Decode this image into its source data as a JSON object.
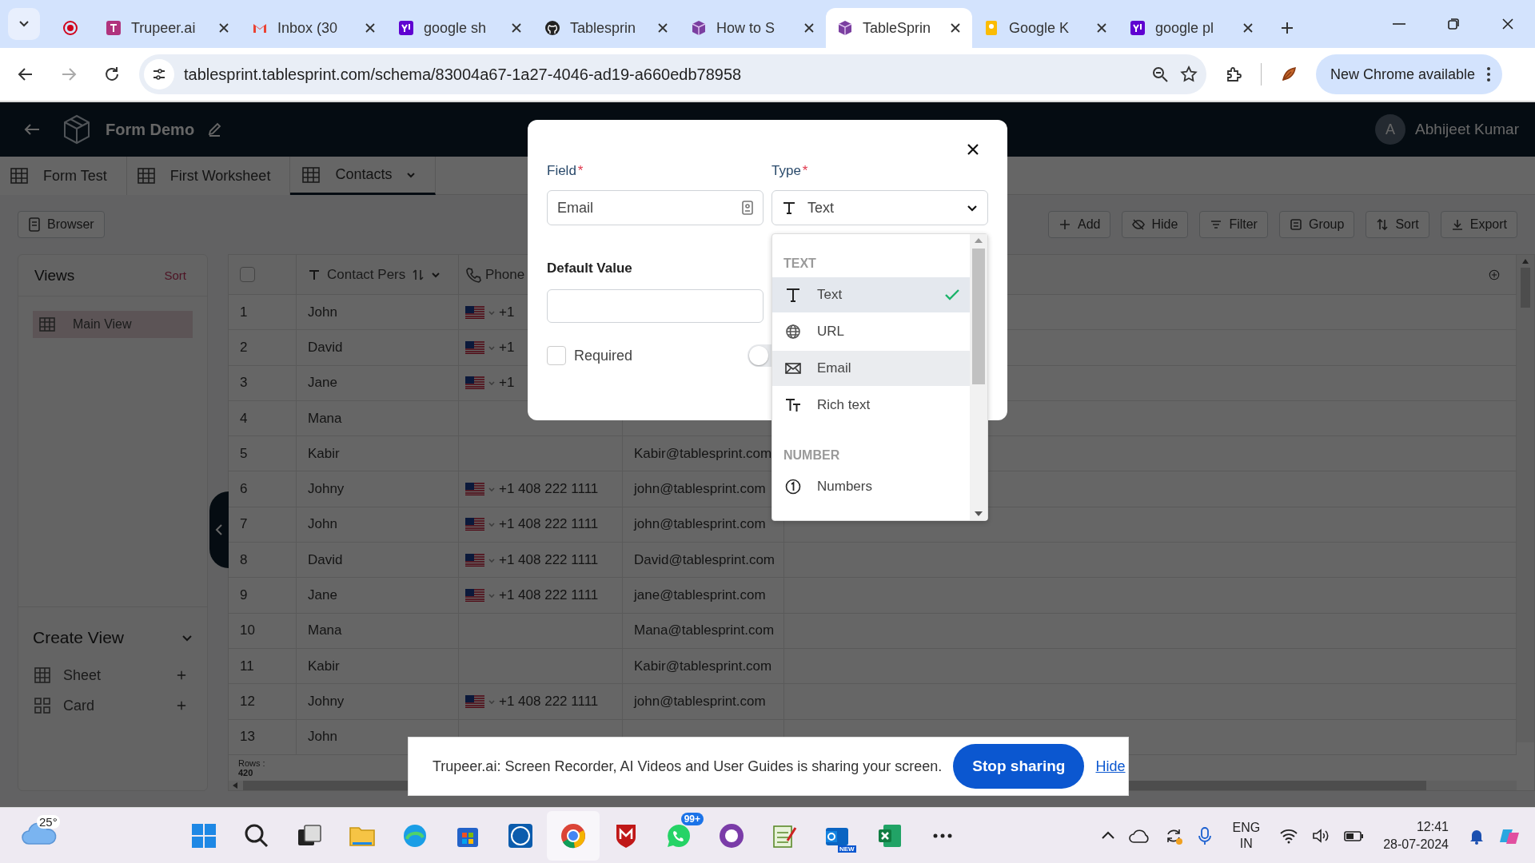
{
  "browser": {
    "tabs": [
      {
        "pinned": true,
        "selected": false
      },
      {
        "title": "Trupeer.ai",
        "selected": false
      },
      {
        "title": "Inbox (30",
        "selected": false
      },
      {
        "title": "google sh",
        "selected": false
      },
      {
        "title": "Tablesprin",
        "selected": false
      },
      {
        "title": "How to S",
        "selected": false
      },
      {
        "title": "TableSprin",
        "selected": true
      },
      {
        "title": "Google K",
        "selected": false
      },
      {
        "title": "google pl",
        "selected": false
      }
    ],
    "url": "tablesprint.tablesprint.com/schema/83004a67-1a27-4046-ad19-a660edb78958",
    "update_button": "New Chrome available"
  },
  "app": {
    "title": "Form Demo",
    "user": {
      "initial": "A",
      "name": "Abhijeet Kumar"
    },
    "sheet_tabs": [
      {
        "label": "Form Test",
        "selected": false
      },
      {
        "label": "First Worksheet",
        "selected": false
      },
      {
        "label": "Contacts",
        "selected": true
      }
    ],
    "toolbar": {
      "left": "Browser",
      "right": [
        "Add",
        "Hide",
        "Filter",
        "Group",
        "Sort",
        "Export"
      ]
    },
    "sidebar": {
      "views_title": "Views",
      "sort_label": "Sort",
      "views": [
        {
          "label": "Main View",
          "selected": true
        }
      ],
      "create_title": "Create View",
      "create_items": [
        "Sheet",
        "Card"
      ]
    },
    "table": {
      "select_all": {
        "checked": false
      },
      "columns": [
        {
          "label": "Contact Pers"
        },
        {
          "label": "Phone"
        }
      ],
      "rows": [
        {
          "num": "1",
          "name": "John",
          "phone": "+1"
        },
        {
          "num": "2",
          "name": "David",
          "phone": "+1"
        },
        {
          "num": "3",
          "name": "Jane",
          "phone": "+1"
        },
        {
          "num": "4",
          "name": "Mana"
        },
        {
          "num": "5",
          "name": "Kabir",
          "email": "Kabir@tablesprint.com"
        },
        {
          "num": "6",
          "name": "Johny",
          "phone": "+1 408 222 1111",
          "email": "john@tablesprint.com"
        },
        {
          "num": "7",
          "name": "John",
          "phone": "+1 408 222 1111",
          "email": "john@tablesprint.com"
        },
        {
          "num": "8",
          "name": "David",
          "phone": "+1 408 222 1111",
          "email": "David@tablesprint.com"
        },
        {
          "num": "9",
          "name": "Jane",
          "phone": "+1 408 222 1111",
          "email": "jane@tablesprint.com"
        },
        {
          "num": "10",
          "name": "Mana",
          "email": "Mana@tablesprint.com"
        },
        {
          "num": "11",
          "name": "Kabir",
          "email": "Kabir@tablesprint.com"
        },
        {
          "num": "12",
          "name": "Johny",
          "phone": "+1 408 222 1111",
          "email": "john@tablesprint.com"
        },
        {
          "num": "13",
          "name": "John"
        }
      ],
      "rows_label": "Rows :",
      "rows_count": "420"
    }
  },
  "modal": {
    "field": {
      "label": "Field",
      "mark": "*",
      "value": "Email"
    },
    "type": {
      "label": "Type",
      "mark": "*",
      "value": "Text"
    },
    "default_value": {
      "label": "Default Value"
    },
    "required": {
      "label": "Required",
      "checked": false
    },
    "toggle": {
      "on": false
    },
    "dropdown": {
      "groups": [
        {
          "title": "TEXT",
          "options": [
            {
              "kind": "text",
              "label": "Text",
              "selected": true,
              "highlighted": false
            },
            {
              "kind": "url",
              "label": "URL",
              "selected": false,
              "highlighted": false
            },
            {
              "kind": "email",
              "label": "Email",
              "selected": false,
              "highlighted": true
            },
            {
              "kind": "rich_text",
              "label": "Rich text",
              "selected": false,
              "highlighted": false
            }
          ]
        },
        {
          "title": "NUMBER",
          "options": [
            {
              "kind": "number",
              "label": "Numbers",
              "selected": false,
              "highlighted": false
            }
          ]
        }
      ]
    }
  },
  "share_bar": {
    "message": "Trupeer.ai: Screen Recorder, AI Videos and User Guides is sharing your screen.",
    "stop_button": "Stop sharing",
    "hide_link": "Hide"
  },
  "taskbar": {
    "weather": "25°",
    "whatsapp_badge": "99+",
    "outlook_badge": "NEW",
    "language": "ENG",
    "region": "IN",
    "time": "12:41",
    "date": "28-07-2024"
  }
}
